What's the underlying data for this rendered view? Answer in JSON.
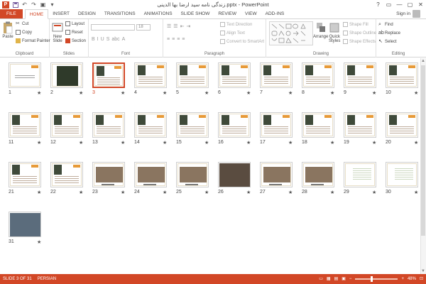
{
  "window": {
    "title": "زندگی نامه سید ارضا بها الدینی.pptx - PowerPoint",
    "controls": [
      "?",
      "▭",
      "—",
      "▢",
      "✕"
    ]
  },
  "qat": {
    "save": "save-icon",
    "undo": "undo-icon",
    "redo": "redo-icon",
    "present": "start-slideshow-icon"
  },
  "tabs": [
    {
      "label": "FILE"
    },
    {
      "label": "HOME",
      "active": true
    },
    {
      "label": "INSERT"
    },
    {
      "label": "DESIGN"
    },
    {
      "label": "TRANSITIONS"
    },
    {
      "label": "ANIMATIONS"
    },
    {
      "label": "SLIDE SHOW"
    },
    {
      "label": "REVIEW"
    },
    {
      "label": "VIEW"
    },
    {
      "label": "ADD-INS"
    }
  ],
  "account": {
    "signin": "Sign in"
  },
  "ribbon": {
    "clipboard": {
      "label": "Clipboard",
      "paste": "Paste",
      "cut": "Cut",
      "copy": "Copy",
      "format_painter": "Format Painter"
    },
    "slides": {
      "label": "Slides",
      "new_slide": "New",
      "new_slide2": "Slide",
      "layout": "Layout",
      "reset": "Reset",
      "section": "Section"
    },
    "font": {
      "label": "Font",
      "size": "18"
    },
    "paragraph": {
      "label": "Paragraph",
      "text_direction": "Text Direction",
      "align_text": "Align Text",
      "smartart": "Convert to SmartArt"
    },
    "drawing": {
      "label": "Drawing",
      "arrange": "Arrange",
      "quick_styles": "Quick",
      "quick_styles2": "Styles",
      "shape_fill": "Shape Fill",
      "shape_outline": "Shape Outline",
      "shape_effects": "Shape Effects"
    },
    "editing": {
      "label": "Editing",
      "find": "Find",
      "replace": "Replace",
      "select": "Select"
    }
  },
  "slides": [
    {
      "n": "1",
      "kind": "title-slide"
    },
    {
      "n": "2",
      "kind": "big-portrait"
    },
    {
      "n": "3",
      "kind": "normal",
      "selected": true
    },
    {
      "n": "4",
      "kind": "normal"
    },
    {
      "n": "5",
      "kind": "normal"
    },
    {
      "n": "6",
      "kind": "normal"
    },
    {
      "n": "7",
      "kind": "normal"
    },
    {
      "n": "8",
      "kind": "normal"
    },
    {
      "n": "9",
      "kind": "normal"
    },
    {
      "n": "10",
      "kind": "normal"
    },
    {
      "n": "11",
      "kind": "normal"
    },
    {
      "n": "12",
      "kind": "normal"
    },
    {
      "n": "13",
      "kind": "normal"
    },
    {
      "n": "14",
      "kind": "normal"
    },
    {
      "n": "15",
      "kind": "normal"
    },
    {
      "n": "16",
      "kind": "normal"
    },
    {
      "n": "17",
      "kind": "normal"
    },
    {
      "n": "18",
      "kind": "normal"
    },
    {
      "n": "19",
      "kind": "normal"
    },
    {
      "n": "20",
      "kind": "normal"
    },
    {
      "n": "21",
      "kind": "normal"
    },
    {
      "n": "22",
      "kind": "normal"
    },
    {
      "n": "23",
      "kind": "photo"
    },
    {
      "n": "24",
      "kind": "photo"
    },
    {
      "n": "25",
      "kind": "photo"
    },
    {
      "n": "26",
      "kind": "photo-dark"
    },
    {
      "n": "27",
      "kind": "photo"
    },
    {
      "n": "28",
      "kind": "photo"
    },
    {
      "n": "29",
      "kind": "faded"
    },
    {
      "n": "30",
      "kind": "faded"
    },
    {
      "n": "31",
      "kind": "laptop"
    }
  ],
  "star": "★",
  "status": {
    "slide_info": "SLIDE 3 OF 31",
    "language": "PERSIAN",
    "zoom": "48%"
  },
  "colors": {
    "accent": "#d24726"
  }
}
